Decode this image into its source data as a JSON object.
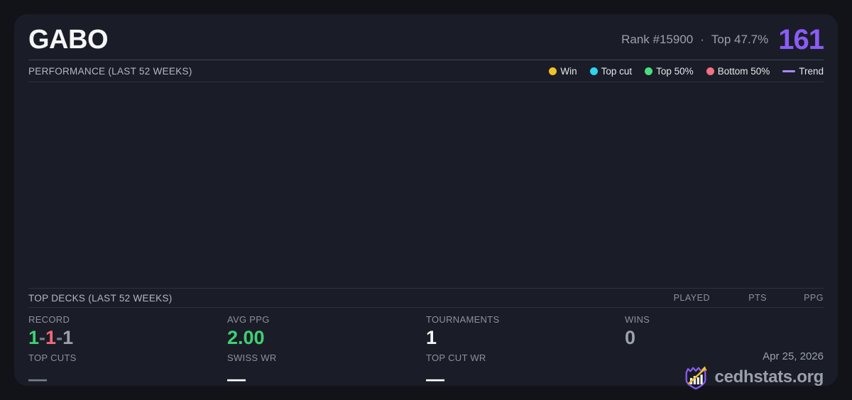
{
  "header": {
    "player_name": "GABO",
    "rank_text": "Rank #15900",
    "separator": "·",
    "top_percent_text": "Top 47.7%",
    "score": "161"
  },
  "performance": {
    "title": "PERFORMANCE (LAST 52 WEEKS)",
    "legend": [
      {
        "label": "Win",
        "color": "#f2c029",
        "marker": "dot"
      },
      {
        "label": "Top cut",
        "color": "#2ed3ee",
        "marker": "dot"
      },
      {
        "label": "Top 50%",
        "color": "#49de80",
        "marker": "dot"
      },
      {
        "label": "Bottom 50%",
        "color": "#f4717f",
        "marker": "dot"
      },
      {
        "label": "Trend",
        "color": "#a78bfa",
        "marker": "line"
      }
    ],
    "chart_empty": true
  },
  "top_decks": {
    "title": "TOP DECKS (LAST 52 WEEKS)",
    "columns": [
      "PLAYED",
      "PTS",
      "PPG"
    ],
    "rows": []
  },
  "stats": {
    "record": {
      "label": "RECORD",
      "wins": "1",
      "losses": "1",
      "draws": "1",
      "separator": "-"
    },
    "avg_ppg": {
      "label": "AVG PPG",
      "value": "2.00"
    },
    "tournaments": {
      "label": "TOURNAMENTS",
      "value": "1"
    },
    "wins": {
      "label": "WINS",
      "value": "0"
    },
    "top_cuts": {
      "label": "TOP CUTS",
      "value": "—"
    },
    "swiss_wr": {
      "label": "SWISS WR",
      "value": "—"
    },
    "top_cut_wr": {
      "label": "TOP CUT WR",
      "value": "—"
    }
  },
  "footer": {
    "date": "Apr 25, 2026",
    "brand": "cedhstats.org"
  },
  "colors": {
    "background": "#111318",
    "card": "#1a1d27",
    "accent_purple": "#8b5cf6",
    "win_yellow": "#f2c029",
    "topcut_cyan": "#2ed3ee",
    "top50_green": "#49de80",
    "bottom50_red": "#f4717f",
    "trend_purple": "#a78bfa",
    "positive_green": "#3fd073",
    "loss_red": "#f4697a",
    "muted_gray": "#9aa1ad",
    "logo_purple": "#8b5cf6",
    "logo_arrow_yellow": "#f2c029"
  }
}
